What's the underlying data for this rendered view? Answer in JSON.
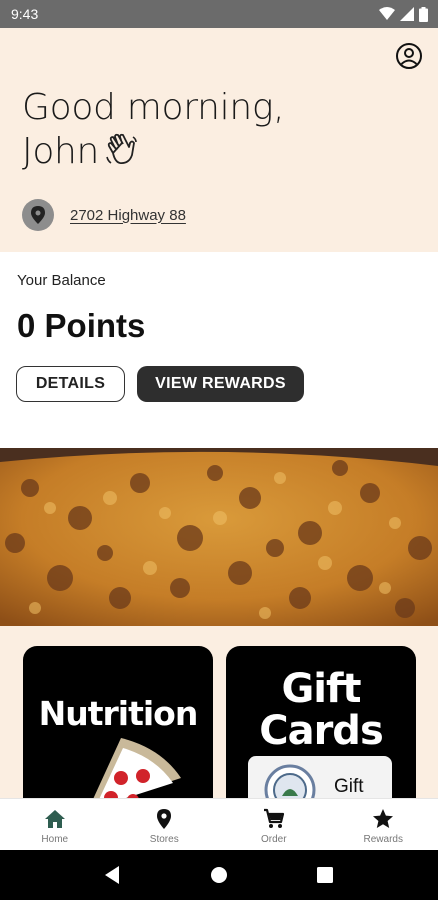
{
  "status_bar": {
    "time": "9:43"
  },
  "header": {
    "greeting_line1": "Good morning,",
    "greeting_line2": "John",
    "address": "2702 Highway 88"
  },
  "balance": {
    "label": "Your Balance",
    "points": "0 Points",
    "details_label": "DETAILS",
    "rewards_label": "VIEW REWARDS"
  },
  "tiles": {
    "nutrition_title": "Nutrition",
    "gift_title_line1": "Gift",
    "gift_title_line2": "Cards",
    "gift_card_text": "Gift"
  },
  "bottom_nav": {
    "items": [
      {
        "label": "Home",
        "icon": "home-icon",
        "active": true
      },
      {
        "label": "Stores",
        "icon": "location-pin-icon",
        "active": false
      },
      {
        "label": "Order",
        "icon": "cart-icon",
        "active": false
      },
      {
        "label": "Rewards",
        "icon": "star-icon",
        "active": false
      }
    ]
  },
  "colors": {
    "header_bg": "#fbeee1",
    "active_nav": "#2f5d50",
    "dark_button": "#2e2e2e"
  }
}
